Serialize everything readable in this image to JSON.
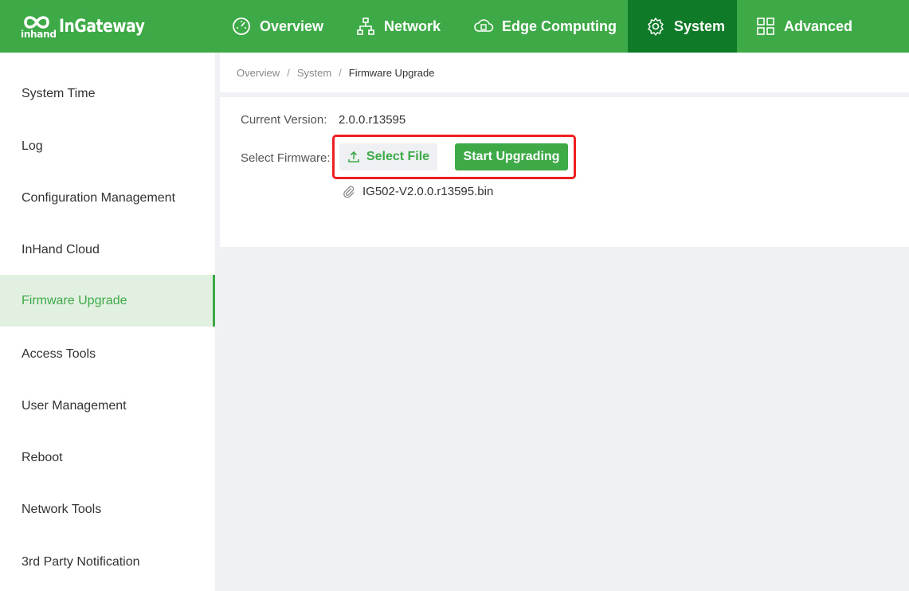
{
  "brand": {
    "name": "InGateway",
    "mark_text": "inhand"
  },
  "nav": {
    "overview": "Overview",
    "network": "Network",
    "edge_computing": "Edge Computing",
    "system": "System",
    "advanced": "Advanced",
    "active": "System"
  },
  "sidebar": {
    "items": [
      {
        "label": "System Time"
      },
      {
        "label": "Log"
      },
      {
        "label": "Configuration Management"
      },
      {
        "label": "InHand Cloud"
      },
      {
        "label": "Firmware Upgrade"
      },
      {
        "label": "Access Tools"
      },
      {
        "label": "User Management"
      },
      {
        "label": "Reboot"
      },
      {
        "label": "Network Tools"
      },
      {
        "label": "3rd Party Notification"
      }
    ],
    "active": "Firmware Upgrade"
  },
  "breadcrumb": {
    "items": [
      "Overview",
      "System",
      "Firmware Upgrade"
    ],
    "separator": "/"
  },
  "firmware": {
    "current_version_label": "Current Version:",
    "current_version": "2.0.0.r13595",
    "select_label": "Select Firmware:",
    "select_button": "Select File",
    "start_button": "Start Upgrading",
    "file_name": "IG502-V2.0.0.r13595.bin"
  },
  "colors": {
    "brand_green": "#3daa47",
    "active_nav": "#0f7a27",
    "highlight": "#ee2020"
  }
}
